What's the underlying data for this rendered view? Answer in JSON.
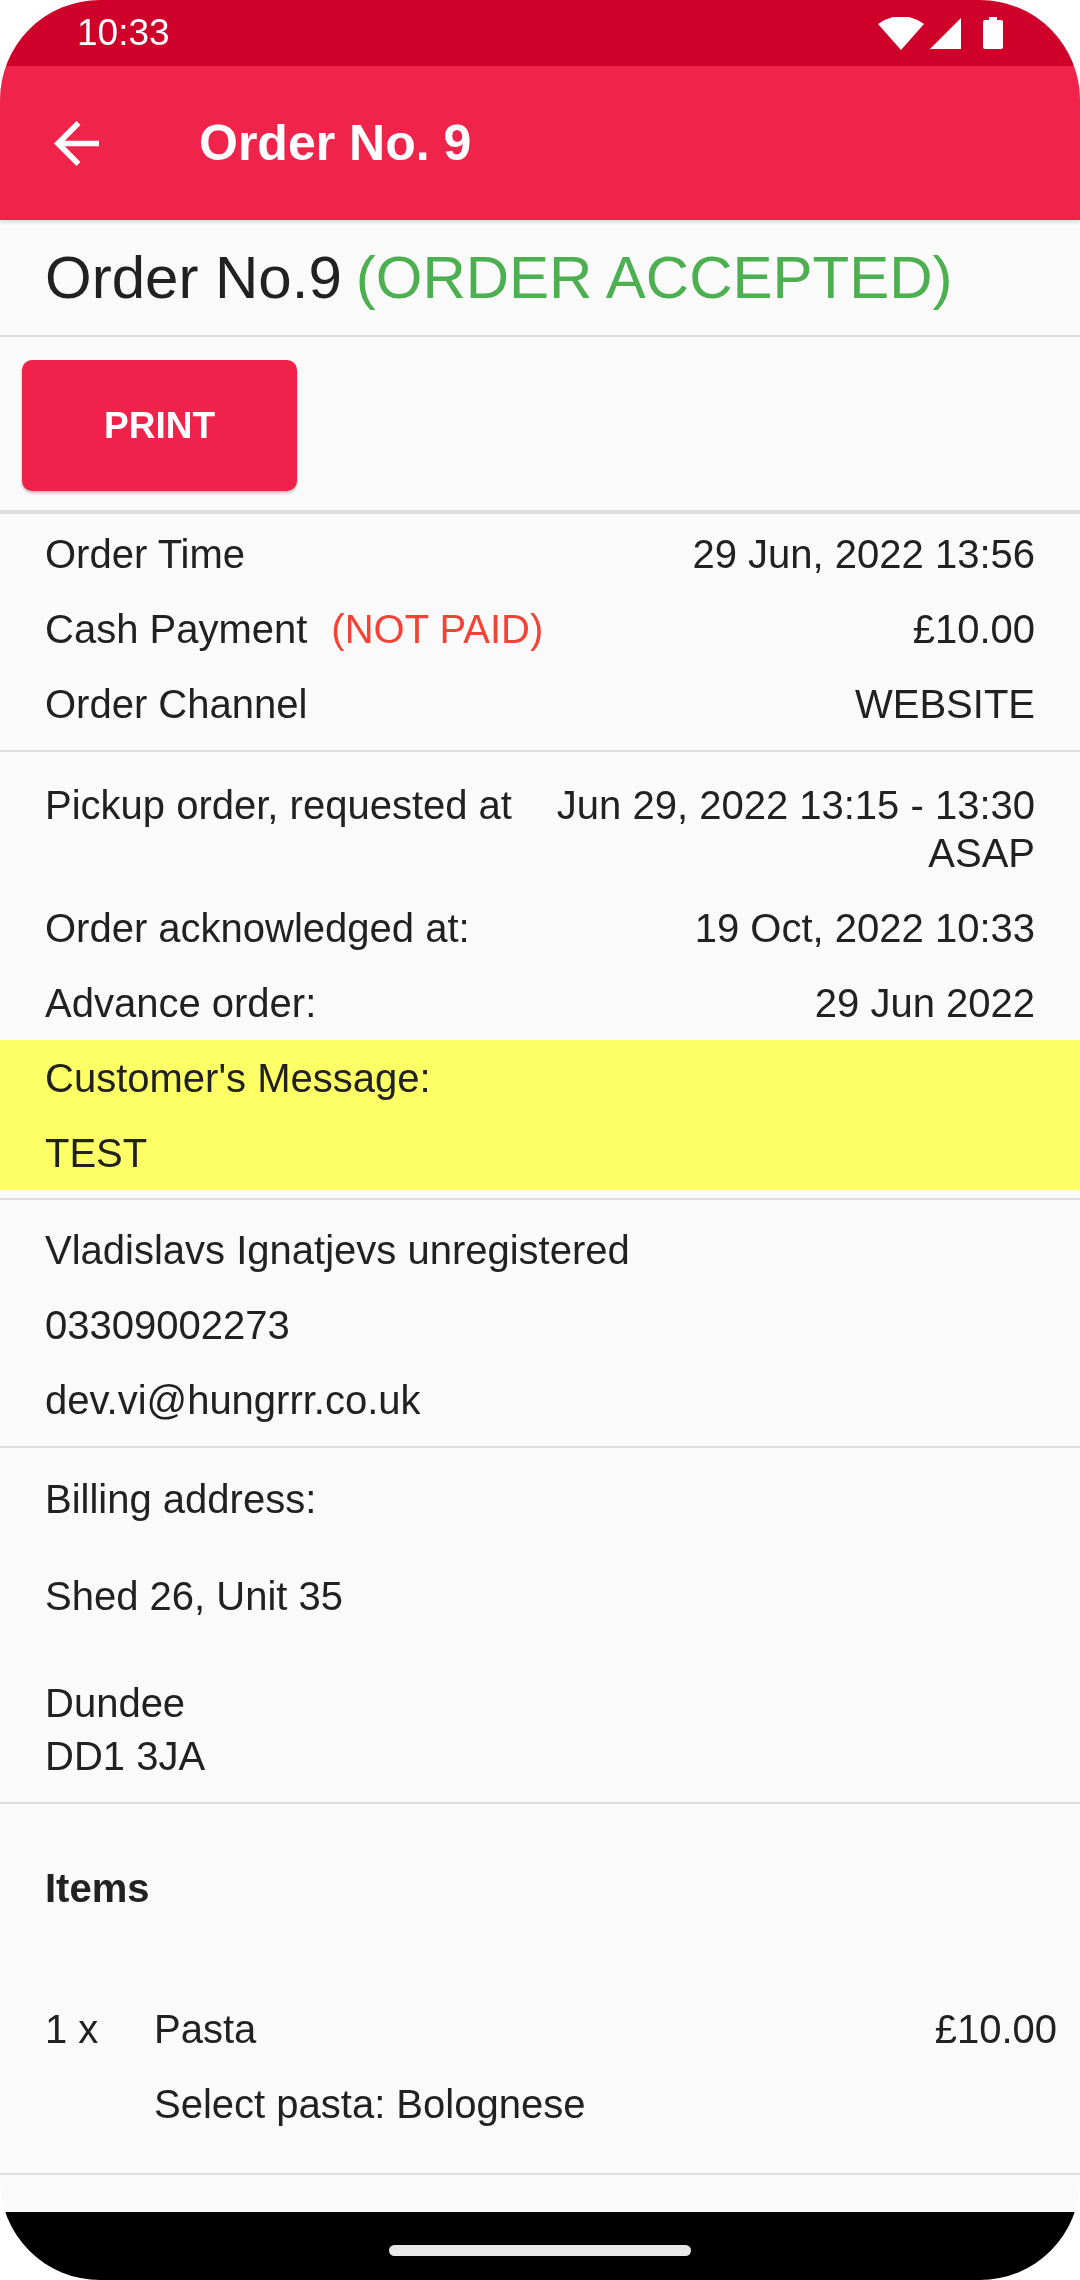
{
  "status_bar": {
    "time": "10:33"
  },
  "app_bar": {
    "title": "Order No. 9"
  },
  "order_header": {
    "title": "Order No.9",
    "status": "(ORDER ACCEPTED)"
  },
  "actions": {
    "print_button": "PRINT"
  },
  "payment_details": [
    {
      "label": "Order Time",
      "value_lines": [
        "29 Jun, 2022 13:56"
      ]
    },
    {
      "label": "Cash Payment",
      "note": "(NOT PAID)",
      "value_lines": [
        "£10.00"
      ]
    },
    {
      "label": "Order Channel",
      "value_lines": [
        "WEBSITE"
      ]
    }
  ],
  "fulfilment_details": [
    {
      "label": "Pickup order, requested at",
      "value_lines": [
        "Jun 29, 2022 13:15 - 13:30",
        "ASAP"
      ]
    },
    {
      "label": "Order acknowledged at:",
      "value_lines": [
        "19 Oct, 2022 10:33"
      ]
    },
    {
      "label": "Advance order:",
      "value_lines": [
        "29 Jun 2022"
      ]
    }
  ],
  "customer_message": {
    "label": "Customer's Message:",
    "text": "TEST"
  },
  "customer": {
    "name": "Vladislavs Ignatjevs unregistered",
    "phone": "03309002273",
    "email": "dev.vi@hungrrr.co.uk"
  },
  "billing_address": {
    "label": "Billing address:",
    "street": "Shed 26, Unit 35",
    "city": "Dundee",
    "postcode": "DD1 3JA"
  },
  "items": {
    "heading": "Items",
    "rows": [
      {
        "quantity": "1 x",
        "name": "Pasta",
        "price": "£10.00",
        "options": [
          "Select pasta: Bolognese"
        ]
      }
    ]
  }
}
